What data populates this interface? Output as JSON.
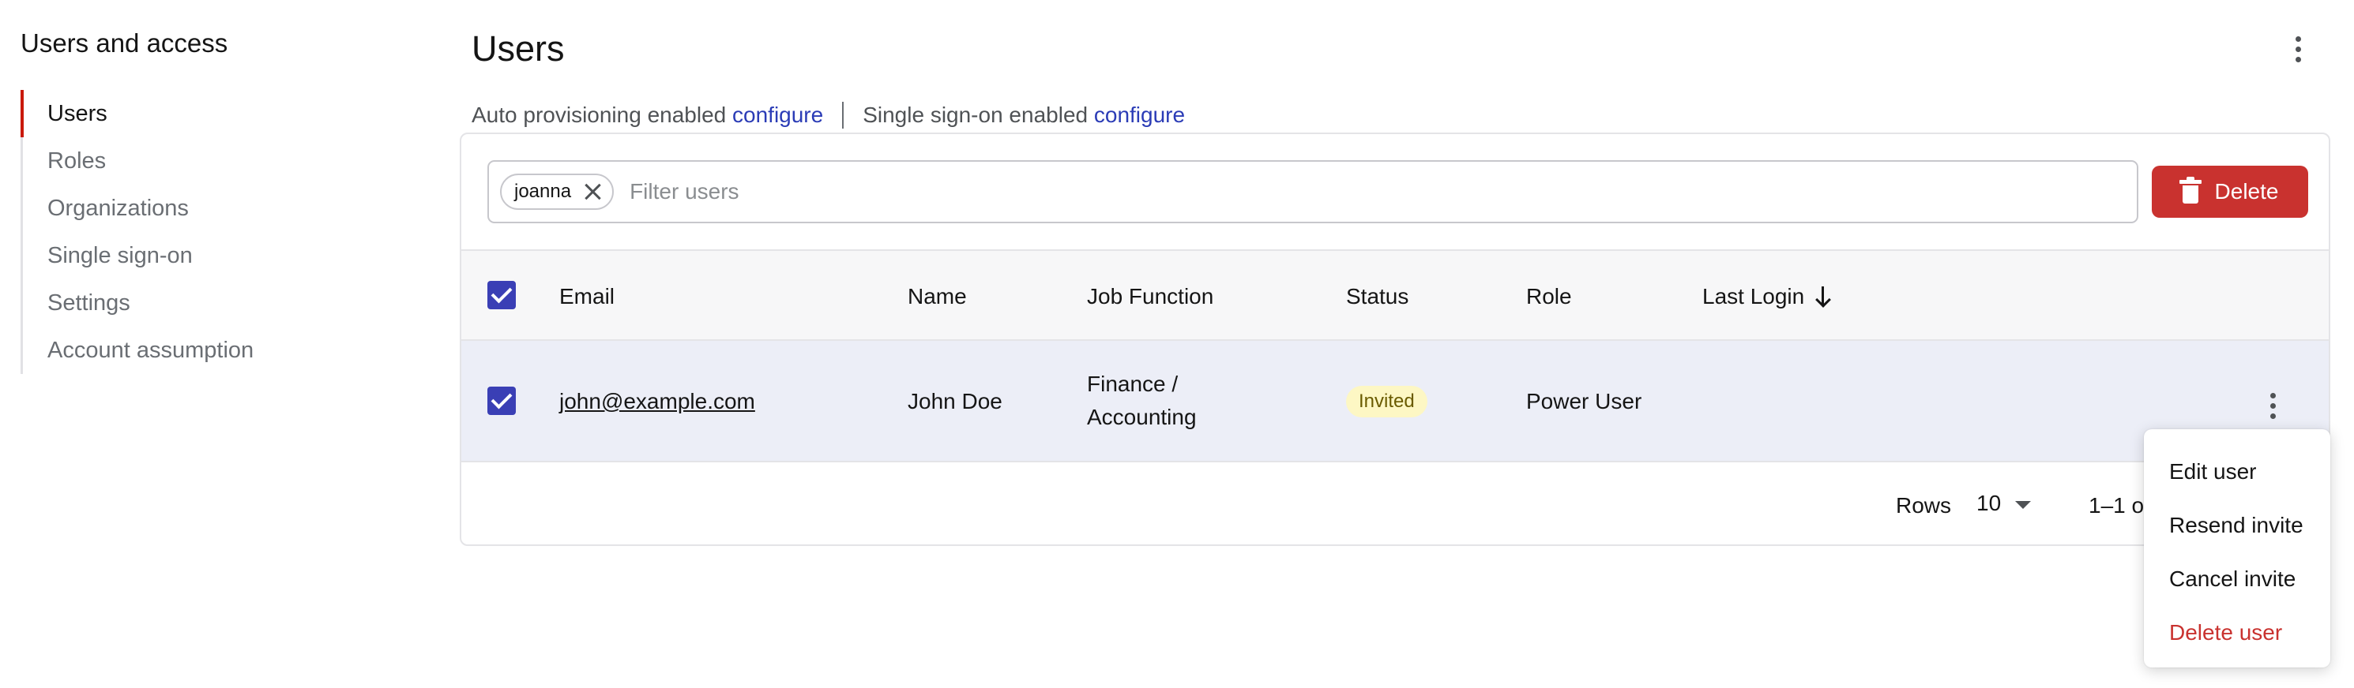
{
  "sidebar": {
    "title": "Users and access",
    "items": [
      {
        "label": "Users",
        "active": true
      },
      {
        "label": "Roles",
        "active": false
      },
      {
        "label": "Organizations",
        "active": false
      },
      {
        "label": "Single sign-on",
        "active": false
      },
      {
        "label": "Settings",
        "active": false
      },
      {
        "label": "Account assumption",
        "active": false
      }
    ]
  },
  "header": {
    "title": "Users",
    "menu_icon": "kebab-icon"
  },
  "subbar": {
    "auto_provisioning_text": "Auto provisioning enabled",
    "auto_provisioning_link": "configure",
    "sso_text": "Single sign-on enabled",
    "sso_link": "configure"
  },
  "toolbar": {
    "chip_label": "joanna",
    "filter_placeholder": "Filter users",
    "delete_label": "Delete"
  },
  "table": {
    "columns": [
      "Email",
      "Name",
      "Job Function",
      "Status",
      "Role",
      "Last Login"
    ],
    "sort_column": "Last Login",
    "sort_direction": "descending",
    "rows": [
      {
        "selected": true,
        "email": "john@example.com",
        "name": "John Doe",
        "job_function_line1": "Finance /",
        "job_function_line2": "Accounting",
        "status": "Invited",
        "role": "Power User",
        "last_login": ""
      }
    ]
  },
  "footer": {
    "rows_label": "Rows",
    "rows_value": "10",
    "range_text": "1–1 o"
  },
  "row_menu": {
    "items": [
      "Edit user",
      "Resend invite",
      "Cancel invite",
      "Delete user"
    ]
  },
  "colors": {
    "accent": "#3a3fb5",
    "link": "#2b3cb6",
    "danger": "#c9322f",
    "nav_active_bar": "#c9190b",
    "badge_bg": "#fdf7c4",
    "selected_row_bg": "#eceef7"
  }
}
